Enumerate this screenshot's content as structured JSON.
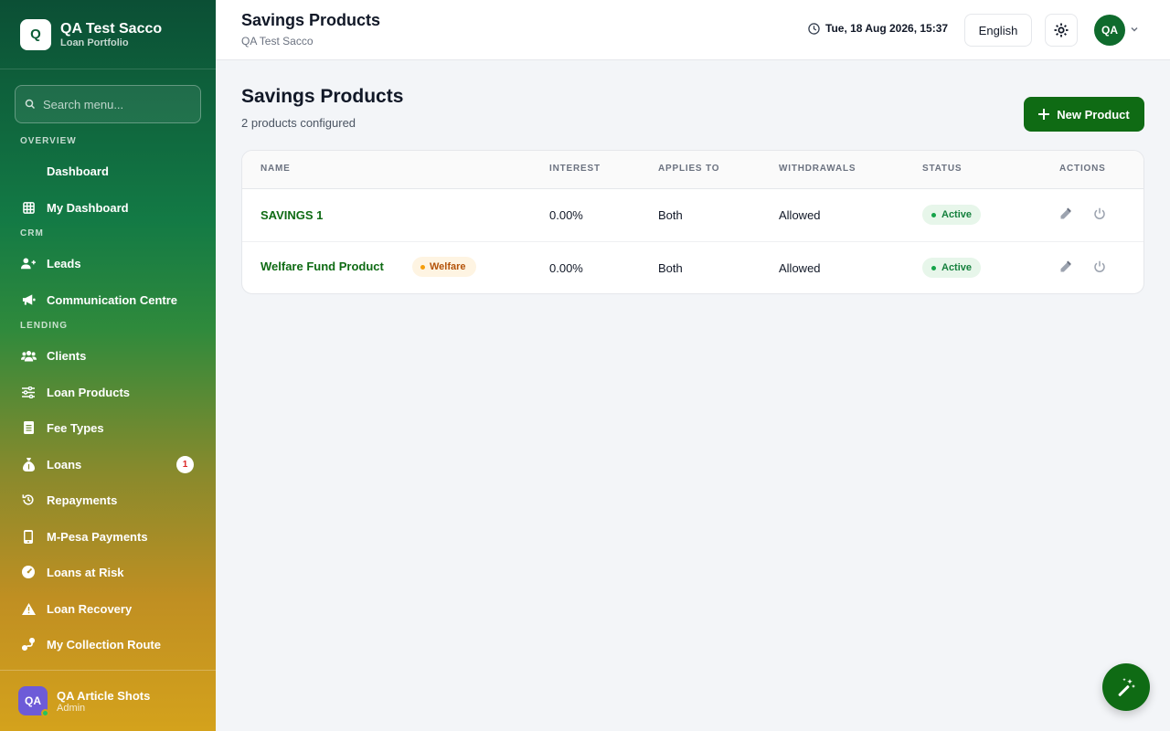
{
  "sidebar": {
    "brand": {
      "logo": "Q",
      "title": "QA Test Sacco",
      "subtitle": "Loan Portfolio"
    },
    "search_placeholder": "Search menu...",
    "sections": {
      "overview": "OVERVIEW",
      "crm": "CRM",
      "lending": "LENDING"
    },
    "items": {
      "dashboard": "Dashboard",
      "my_dashboard": "My Dashboard",
      "leads": "Leads",
      "communication": "Communication Centre",
      "clients": "Clients",
      "loan_products": "Loan Products",
      "fee_types": "Fee Types",
      "loans": "Loans",
      "loans_badge": "1",
      "repayments": "Repayments",
      "mpesa": "M-Pesa Payments",
      "loans_at_risk": "Loans at Risk",
      "loan_recovery": "Loan Recovery",
      "collection_route": "My Collection Route"
    },
    "user": {
      "initials": "QA",
      "name": "QA Article Shots",
      "role": "Admin"
    }
  },
  "topbar": {
    "title": "Savings Products",
    "subtitle": "QA Test Sacco",
    "datetime": "Tue, 18 Aug 2026, 15:37",
    "language": "English",
    "avatar": "QA"
  },
  "main": {
    "title": "Savings Products",
    "subtitle": "2 products configured",
    "new_button": "New Product",
    "table": {
      "headers": {
        "name": "NAME",
        "interest": "INTEREST",
        "applies_to": "APPLIES TO",
        "withdrawals": "WITHDRAWALS",
        "status": "STATUS",
        "actions": "ACTIONS"
      },
      "rows": [
        {
          "name": "SAVINGS 1",
          "tag": "",
          "interest": "0.00%",
          "applies_to": "Both",
          "withdrawals": "Allowed",
          "status": "Active"
        },
        {
          "name": "Welfare Fund Product",
          "tag": "Welfare",
          "interest": "0.00%",
          "applies_to": "Both",
          "withdrawals": "Allowed",
          "status": "Active"
        }
      ]
    }
  },
  "colors": {
    "primary": "#0f6b14",
    "sidebar_top": "#0b4f35",
    "sidebar_bottom": "#d4a21c",
    "active_bg": "#e7f6ea",
    "welfare_bg": "#fef4e2"
  }
}
